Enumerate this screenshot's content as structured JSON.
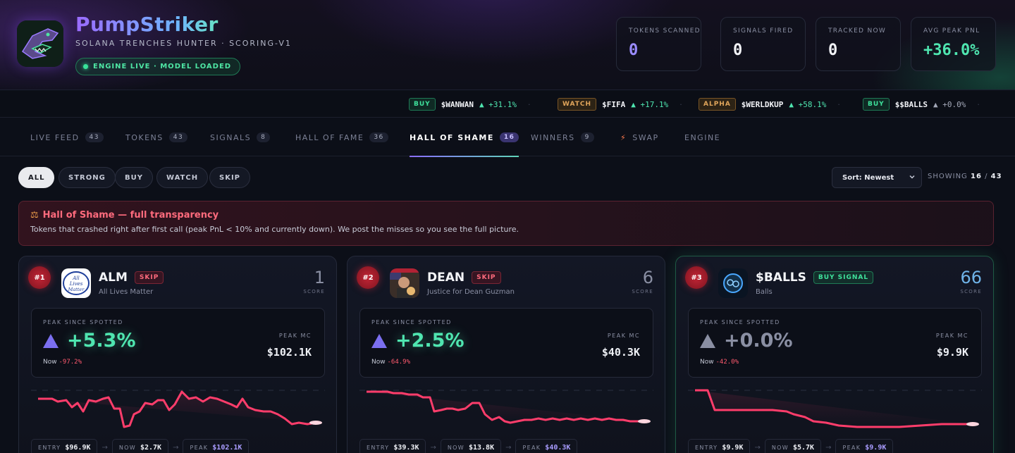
{
  "brand": {
    "title": "PumpStriker",
    "subtitle": "SOLANA TRENCHES HUNTER · SCORING-V1",
    "engine_status": "ENGINE LIVE · MODEL LOADED"
  },
  "stats": [
    {
      "label": "TOKENS SCANNED",
      "value": "0",
      "color": "#9b8cff"
    },
    {
      "label": "SIGNALS FIRED",
      "value": "0",
      "color": "#f2f3f7"
    },
    {
      "label": "TRACKED NOW",
      "value": "0",
      "color": "#f2f3f7"
    },
    {
      "label": "AVG PEAK PNL",
      "value": "+36.0%",
      "color": "#4fe6b0"
    }
  ],
  "ticker": [
    {
      "tag": "BUY",
      "symbol": "$WANWAN",
      "change": "▲ +31.1%",
      "tone": "up"
    },
    {
      "tag": "WATCH",
      "symbol": "$FIFA",
      "change": "▲ +17.1%",
      "tone": "up"
    },
    {
      "tag": "ALPHA",
      "symbol": "$WERLDKUP",
      "change": "▲ +58.1%",
      "tone": "up"
    },
    {
      "tag": "BUY",
      "symbol": "$$BALLS",
      "change": "▲ +0.0%",
      "tone": "flat"
    }
  ],
  "tabs": [
    {
      "label": "LIVE FEED",
      "count": "43"
    },
    {
      "label": "TOKENS",
      "count": "43"
    },
    {
      "label": "SIGNALS",
      "count": "8"
    },
    {
      "label": "HALL OF FAME",
      "count": "36"
    },
    {
      "label": "HALL OF SHAME",
      "count": "16"
    },
    {
      "label": "WINNERS",
      "count": "9"
    },
    {
      "label": "SWAP",
      "count": ""
    },
    {
      "label": "ENGINE",
      "count": ""
    }
  ],
  "active_tab": "HALL OF SHAME",
  "filters": [
    "ALL",
    "STRONG",
    "BUY",
    "WATCH",
    "SKIP"
  ],
  "active_filter": "ALL",
  "sort": {
    "label": "Sort: Newest"
  },
  "showing": {
    "label": "SHOWING",
    "shown": "16",
    "sep": "/",
    "total": "43"
  },
  "banner": {
    "icon": "⚖",
    "title": "Hall of Shame — full transparency",
    "text": "Tokens that crashed right after first call (peak PnL < 10% and currently down). We post the misses so you see the full picture."
  },
  "cards": [
    {
      "rank": "#1",
      "symbol": "ALM",
      "badge": "SKIP",
      "name": "All Lives Matter",
      "score": "1",
      "score_label": "SCORE",
      "peak_label": "PEAK SINCE SPOTTED",
      "peak": "+5.3%",
      "now_label": "Now",
      "now": "-97.2%",
      "mc_label": "PEAK MC",
      "mc": "$102.1K",
      "entry_label": "ENTRY",
      "entry": "$96.9K",
      "now_pill_label": "NOW",
      "now_mc": "$2.7K",
      "peak_pill_label": "PEAK",
      "peak_mc": "$102.1K"
    },
    {
      "rank": "#2",
      "symbol": "DEAN",
      "badge": "SKIP",
      "name": "Justice for Dean Guzman",
      "score": "6",
      "score_label": "SCORE",
      "peak_label": "PEAK SINCE SPOTTED",
      "peak": "+2.5%",
      "now_label": "Now",
      "now": "-64.9%",
      "mc_label": "PEAK MC",
      "mc": "$40.3K",
      "entry_label": "ENTRY",
      "entry": "$39.3K",
      "now_pill_label": "NOW",
      "now_mc": "$13.8K",
      "peak_pill_label": "PEAK",
      "peak_mc": "$40.3K"
    },
    {
      "rank": "#3",
      "symbol": "$BALLS",
      "badge": "BUY SIGNAL",
      "name": "Balls",
      "score": "66",
      "score_label": "SCORE",
      "peak_label": "PEAK SINCE SPOTTED",
      "peak": "+0.0%",
      "now_label": "Now",
      "now": "-42.0%",
      "mc_label": "PEAK MC",
      "mc": "$9.9K",
      "entry_label": "ENTRY",
      "entry": "$9.9K",
      "now_pill_label": "NOW",
      "now_mc": "$5.7K",
      "peak_pill_label": "PEAK",
      "peak_mc": "$9.9K"
    }
  ],
  "colors": {
    "accent": "#8a6cff",
    "up": "#4fe6b0",
    "down": "#ff5a6e",
    "line": "#ff3d6b"
  }
}
